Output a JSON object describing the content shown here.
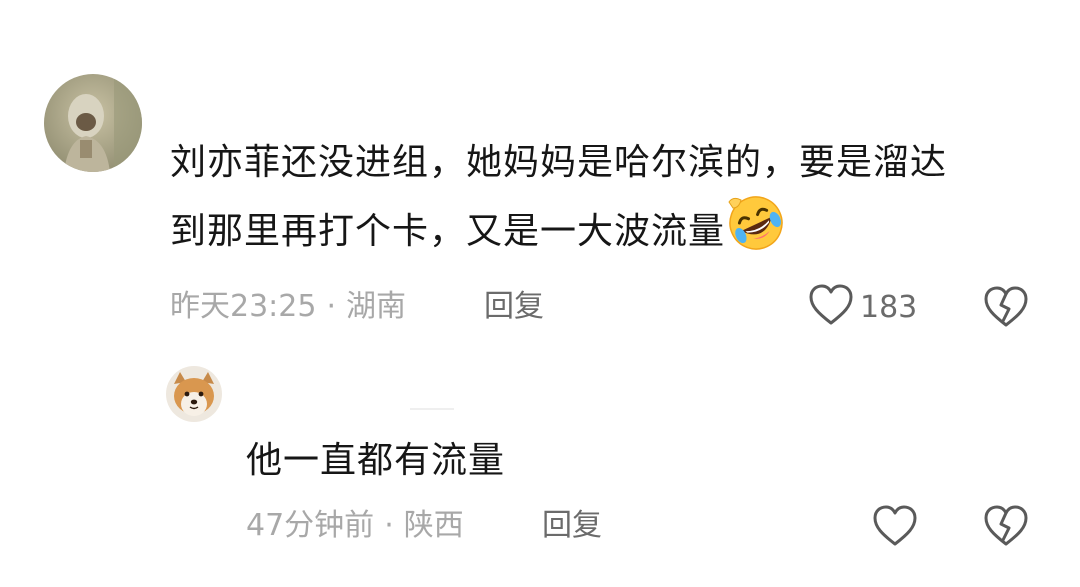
{
  "comment": {
    "text_line1": "刘亦菲还没进组，她妈妈是哈尔滨的，要是溜达",
    "text_line2": "到那里再打个卡，又是一大波流量",
    "emoji": "rolling-on-floor-laughing-emoji",
    "time": "昨天23:25",
    "separator": "·",
    "location": "湖南",
    "reply_label": "回复",
    "like_count": "183"
  },
  "reply": {
    "text": "他一直都有流量",
    "time": "47分钟前",
    "separator": "·",
    "location": "陕西",
    "reply_label": "回复"
  },
  "icons": {
    "like": "heart-outline-icon",
    "dislike": "broken-heart-icon"
  },
  "colors": {
    "text": "#161616",
    "meta": "#a8a8a8",
    "action": "#6b6b6b",
    "icon": "#5a5a5a"
  }
}
